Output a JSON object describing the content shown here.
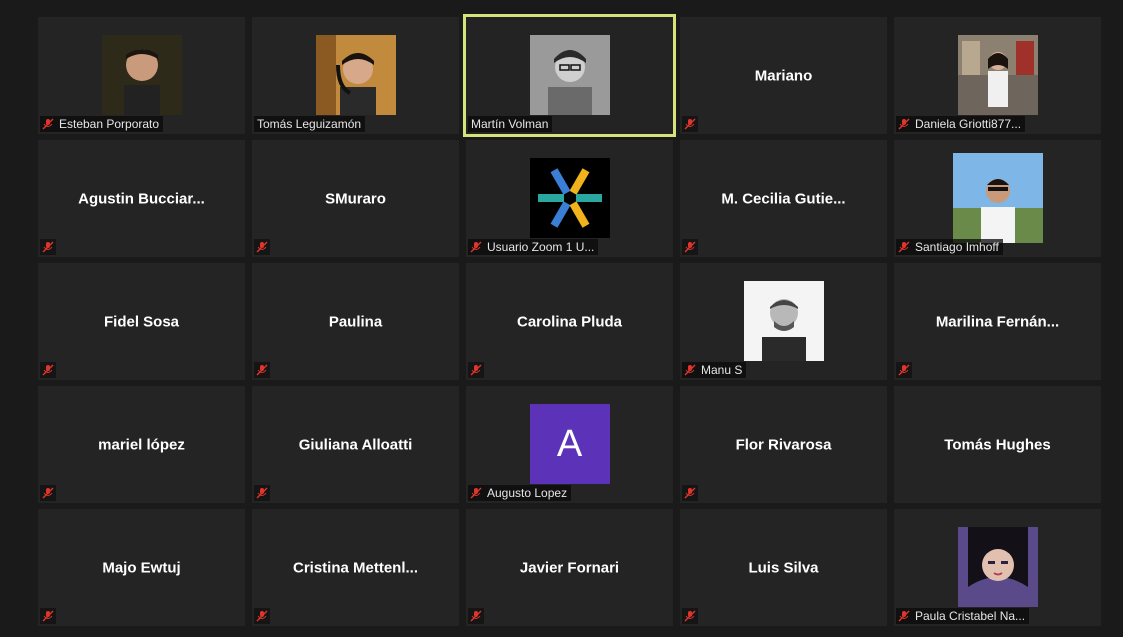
{
  "participants": [
    {
      "name": "Esteban Porporato",
      "video": true
    },
    {
      "name": "Tomás Leguizamón",
      "video": true
    },
    {
      "name": "Martín Volman",
      "video": true,
      "active_speaker": true
    },
    {
      "name": "Mariano",
      "video": false
    },
    {
      "name": "Daniela Griotti877...",
      "video": true
    },
    {
      "name": "Agustin  Bucciar...",
      "video": false
    },
    {
      "name": "SMuraro",
      "video": false
    },
    {
      "name": "Usuario Zoom 1 U...",
      "video": true,
      "icon": "zoom-logo"
    },
    {
      "name": "M. Cecilia  Gutie...",
      "video": false
    },
    {
      "name": "Santiago Imhoff",
      "video": true
    },
    {
      "name": "Fidel Sosa",
      "video": false
    },
    {
      "name": "Paulina",
      "video": false
    },
    {
      "name": "Carolina Pluda",
      "video": false
    },
    {
      "name": "Manu S",
      "video": true
    },
    {
      "name": "Marilina  Fernán...",
      "video": false
    },
    {
      "name": "mariel lópez",
      "video": false
    },
    {
      "name": "Giuliana Alloatti",
      "video": false
    },
    {
      "name": "Augusto Lopez",
      "video": true,
      "avatar_letter": "A"
    },
    {
      "name": "Flor Rivarosa",
      "video": false
    },
    {
      "name": "Tomás Hughes",
      "video": false
    },
    {
      "name": "Majo Ewtuj",
      "video": false
    },
    {
      "name": "Cristina  Mettenl...",
      "video": false
    },
    {
      "name": "Javier Fornari",
      "video": false
    },
    {
      "name": "Luis Silva",
      "video": false
    },
    {
      "name": "Paula Cristabel Na...",
      "video": true
    }
  ],
  "tile_labels_shown": [
    "Esteban Porporato",
    "Tomás Leguizamón",
    "Martín Volman",
    "",
    "Daniela Griotti877...",
    "",
    "",
    "Usuario Zoom 1 U...",
    "",
    "Santiago Imhoff",
    "",
    "",
    "",
    "Manu S",
    "",
    "",
    "",
    "Augusto Lopez",
    "",
    "",
    "",
    "",
    "",
    "",
    "Paula Cristabel Na..."
  ],
  "center_names": [
    "",
    "",
    "",
    "Mariano",
    "",
    "Agustin  Bucciar...",
    "SMuraro",
    "",
    "M. Cecilia  Gutie...",
    "",
    "Fidel Sosa",
    "Paulina",
    "Carolina Pluda",
    "",
    "Marilina  Fernán...",
    "mariel lópez",
    "Giuliana Alloatti",
    "",
    "Flor Rivarosa",
    "Tomás Hughes",
    "Majo Ewtuj",
    "Cristina  Mettenl...",
    "Javier Fornari",
    "Luis Silva",
    ""
  ],
  "avatar_letter": "A",
  "colors": {
    "background": "#1a1a1a",
    "tile": "#242424",
    "active_border": "#d5e37a",
    "mute_icon": "#e0352b",
    "avatar_purple": "#5c33b8"
  },
  "icons": {
    "mute": "microphone-muted-icon"
  }
}
